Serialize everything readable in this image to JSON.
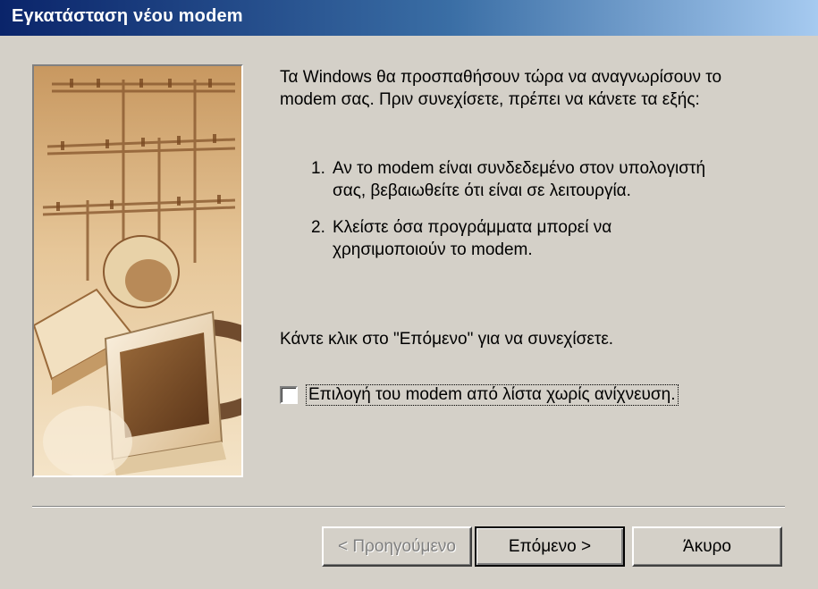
{
  "window": {
    "title": "Εγκατάσταση νέου modem"
  },
  "intro": "Τα Windows θα προσπαθήσουν τώρα να αναγνωρίσουν το modem σας.  Πριν συνεχίσετε, πρέπει να κάνετε τα εξής:",
  "steps": [
    {
      "num": "1.",
      "text": "Αν το modem είναι συνδεδεμένο στον υπολογιστή σας, βεβαιωθείτε ότι είναι σε λειτουργία."
    },
    {
      "num": "2.",
      "text": "Κλείστε όσα προγράμματα μπορεί να χρησιμοποιούν το modem."
    }
  ],
  "hint": "Κάντε κλικ στο \"Επόμενο\" για να συνεχίσετε.",
  "checkbox": {
    "label_before": "Επιλογή του modem από λίστα ",
    "label_underlined": "χ",
    "label_after": "ωρίς ανίχνευση.",
    "checked": false
  },
  "buttons": {
    "back": "< Προηγούμενο",
    "next": "Επόμενο >",
    "cancel": "Άκυρο"
  },
  "colors": {
    "dialog_bg": "#d4d0c8",
    "titlebar_start": "#0a246a",
    "titlebar_end": "#a6caf0",
    "illustration_tone": "#c8a070"
  }
}
